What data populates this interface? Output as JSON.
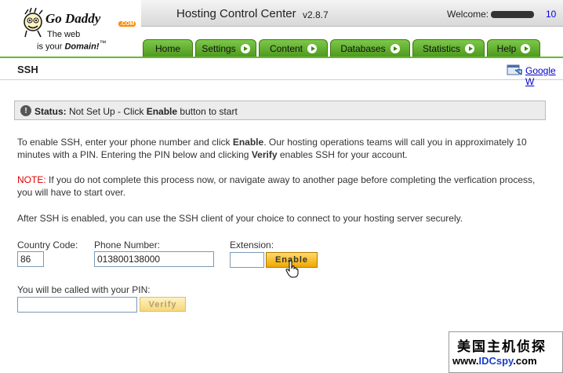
{
  "header": {
    "logo": {
      "brand": "Go Daddy",
      "com_badge": ".COM",
      "tagline_line1": "The web",
      "tagline_line2_prefix": "is your ",
      "tagline_line2_bold": "Domain!",
      "tagline_tm": "™"
    },
    "title": "Hosting Control Center",
    "version": "v2.8.7",
    "welcome_label": "Welcome:",
    "user_fragment": "10"
  },
  "tabs": [
    {
      "label": "Home",
      "has_arrow": false
    },
    {
      "label": "Settings",
      "has_arrow": true
    },
    {
      "label": "Content",
      "has_arrow": true
    },
    {
      "label": "Databases",
      "has_arrow": true
    },
    {
      "label": "Statistics",
      "has_arrow": true
    },
    {
      "label": "Help",
      "has_arrow": true
    }
  ],
  "page": {
    "title": "SSH",
    "google_link": "Google W"
  },
  "status": {
    "label": "Status:",
    "text_before": " Not Set Up - Click ",
    "text_bold": "Enable",
    "text_after": " button to start"
  },
  "paragraphs": {
    "intro_a": "To enable SSH, enter your phone number and click ",
    "intro_bold1": "Enable",
    "intro_b": ". Our hosting operations teams will call you in approximately 10 minutes with a PIN. Entering the PIN below and clicking ",
    "intro_bold2": "Verify",
    "intro_c": " enables SSH for your account.",
    "note_label": "NOTE:",
    "note_text": " If you do not complete this process now, or navigate away to another page before completing the verfication process, you will have to start over.",
    "after": "After SSH is enabled, you can use the SSH client of your choice to connect to your hosting server securely."
  },
  "form": {
    "country_code_label": "Country Code:",
    "country_code_value": "86",
    "phone_label": "Phone Number:",
    "phone_value": "013800138000",
    "extension_label": "Extension:",
    "extension_value": "",
    "enable_button": "Enable",
    "pin_label": "You will be called with your PIN:",
    "pin_value": "",
    "verify_button": "Verify"
  },
  "watermark": {
    "line1": "美国主机侦探",
    "line2_prefix": "www.",
    "line2_highlight": "IDCspy",
    "line2_suffix": ".com"
  },
  "colors": {
    "tab_green": "#6bb636",
    "note_red": "#e00000",
    "enable_orange": "#f0a800"
  }
}
